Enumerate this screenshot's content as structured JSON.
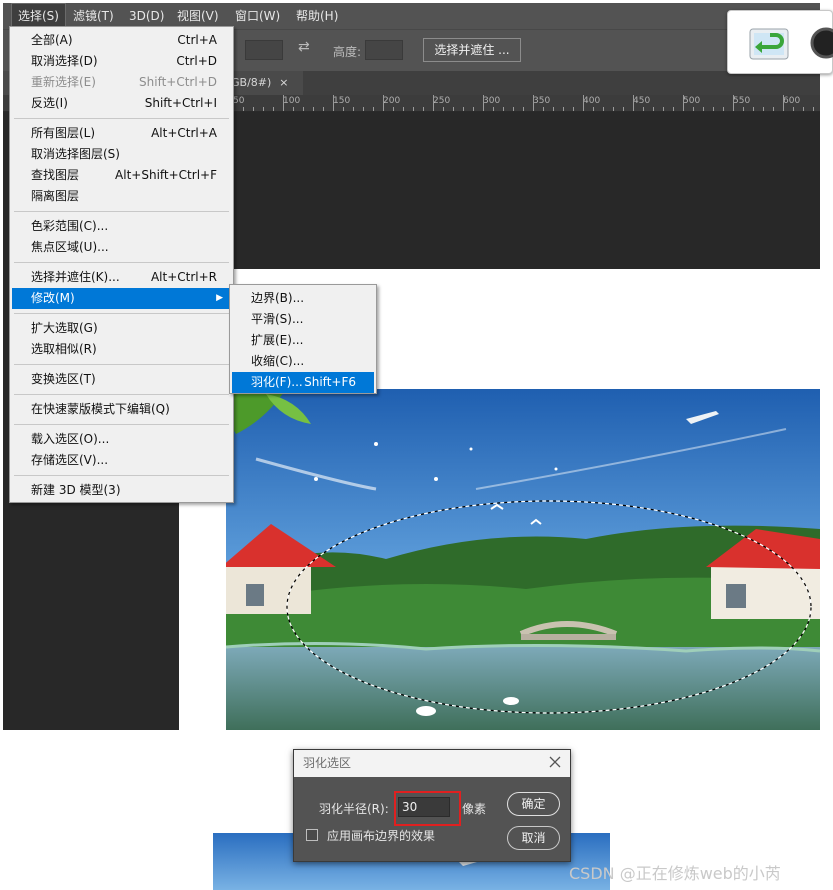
{
  "menubar": {
    "items": [
      "选择(S)",
      "滤镜(T)",
      "3D(D)",
      "视图(V)",
      "窗口(W)",
      "帮助(H)"
    ]
  },
  "options_bar": {
    "height_label": "高度:",
    "refine_button": "选择并遮住 ..."
  },
  "document_tab": {
    "title_fragment": "GB/8#)",
    "close": "×"
  },
  "ruler": {
    "labels": [
      "50",
      "100",
      "150",
      "200",
      "250",
      "300",
      "350",
      "400",
      "450",
      "500",
      "550",
      "600"
    ]
  },
  "select_menu": {
    "items": [
      {
        "label": "全部(A)",
        "shortcut": "Ctrl+A",
        "disabled": false
      },
      {
        "label": "取消选择(D)",
        "shortcut": "Ctrl+D",
        "disabled": false
      },
      {
        "label": "重新选择(E)",
        "shortcut": "Shift+Ctrl+D",
        "disabled": true
      },
      {
        "label": "反选(I)",
        "shortcut": "Shift+Ctrl+I",
        "disabled": false
      },
      {
        "label": "所有图层(L)",
        "shortcut": "Alt+Ctrl+A",
        "disabled": false
      },
      {
        "label": "取消选择图层(S)",
        "shortcut": "",
        "disabled": false
      },
      {
        "label": "查找图层",
        "shortcut": "Alt+Shift+Ctrl+F",
        "disabled": false
      },
      {
        "label": "隔离图层",
        "shortcut": "",
        "disabled": false
      },
      {
        "label": "色彩范围(C)...",
        "shortcut": "",
        "disabled": false
      },
      {
        "label": "焦点区域(U)...",
        "shortcut": "",
        "disabled": false
      },
      {
        "label": "选择并遮住(K)...",
        "shortcut": "Alt+Ctrl+R",
        "disabled": false
      },
      {
        "label": "修改(M)",
        "shortcut": "",
        "disabled": false,
        "submenu": true,
        "highlighted": true
      },
      {
        "label": "扩大选取(G)",
        "shortcut": "",
        "disabled": false
      },
      {
        "label": "选取相似(R)",
        "shortcut": "",
        "disabled": false
      },
      {
        "label": "变换选区(T)",
        "shortcut": "",
        "disabled": false
      },
      {
        "label": "在快速蒙版模式下编辑(Q)",
        "shortcut": "",
        "disabled": false
      },
      {
        "label": "载入选区(O)...",
        "shortcut": "",
        "disabled": false
      },
      {
        "label": "存储选区(V)...",
        "shortcut": "",
        "disabled": false
      },
      {
        "label": "新建 3D 模型(3)",
        "shortcut": "",
        "disabled": false
      }
    ],
    "submenu_arrow": "▶"
  },
  "modify_submenu": {
    "items": [
      {
        "label": "边界(B)...",
        "shortcut": ""
      },
      {
        "label": "平滑(S)...",
        "shortcut": ""
      },
      {
        "label": "扩展(E)...",
        "shortcut": ""
      },
      {
        "label": "收缩(C)...",
        "shortcut": ""
      },
      {
        "label": "羽化(F)...",
        "shortcut": "Shift+F6",
        "highlighted": true
      }
    ]
  },
  "feather_dialog": {
    "title": "羽化选区",
    "close_icon": "close-icon",
    "radius_label": "羽化半径(R):",
    "radius_value": "30",
    "unit": "像素",
    "checkbox_label": "应用画布边界的效果",
    "checkbox_checked": false,
    "ok_label": "确定",
    "cancel_label": "取消"
  },
  "watermark": "CSDN @正在修炼web的小芮",
  "colors": {
    "highlight": "#0078d7",
    "ps_dark": "#282828",
    "ps_panel": "#535353",
    "red_annotation": "#e02020"
  }
}
